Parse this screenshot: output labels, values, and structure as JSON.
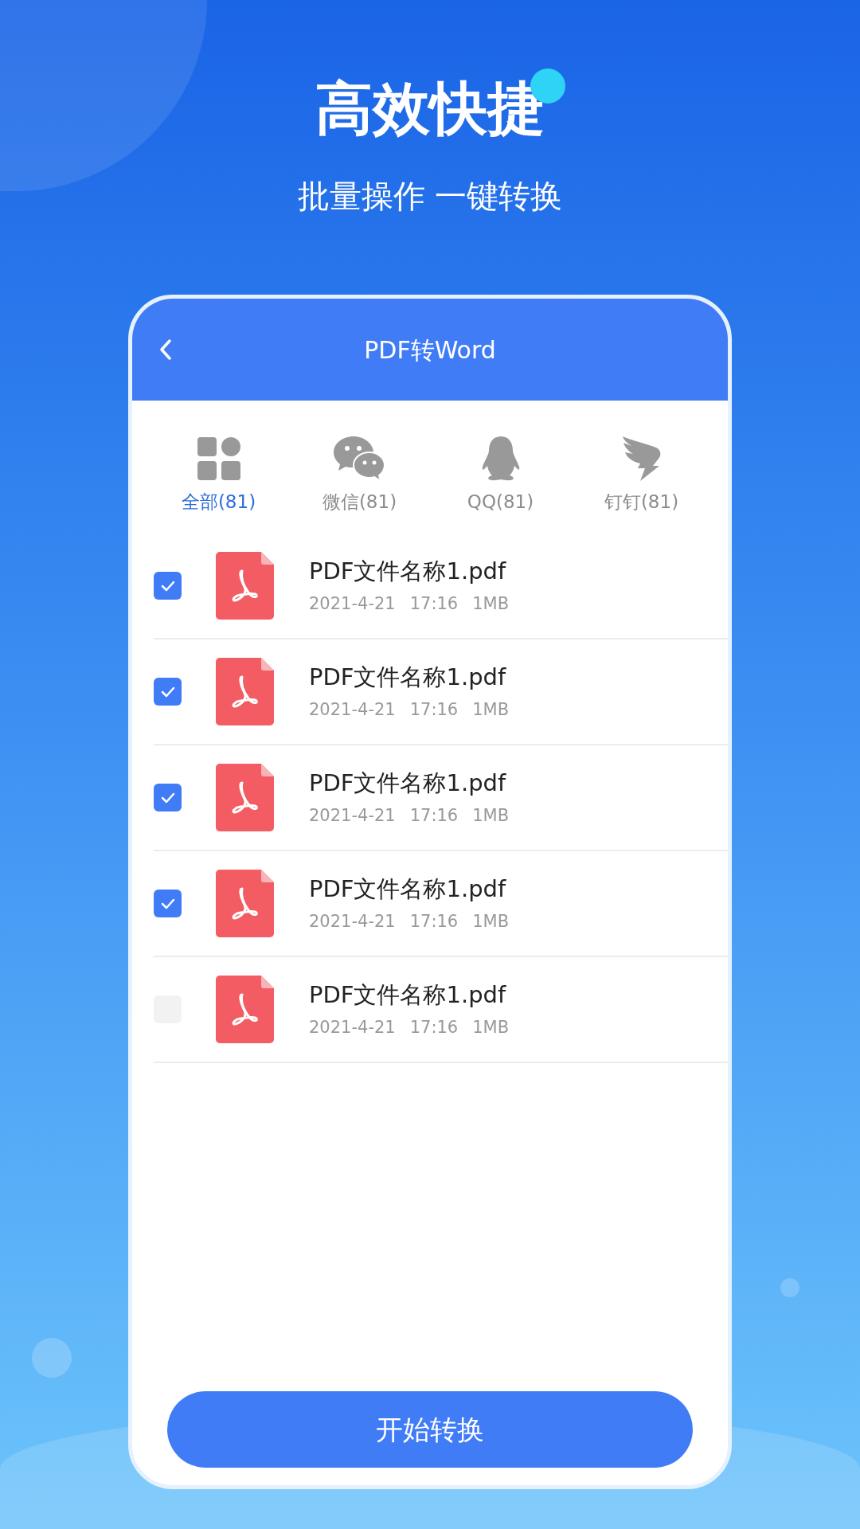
{
  "headline": "高效快捷",
  "subtitle": "批量操作 一键转换",
  "screen": {
    "title": "PDF转Word",
    "tabs": [
      {
        "kind": "all",
        "label": "全部(81)",
        "selected": true
      },
      {
        "kind": "chat",
        "label": "微信(81)",
        "selected": false
      },
      {
        "kind": "penguin",
        "label": "QQ(81)",
        "selected": false
      },
      {
        "kind": "wing",
        "label": "钉钉(81)",
        "selected": false
      }
    ],
    "files": [
      {
        "name": "PDF文件名称1.pdf",
        "date": "2021-4-21",
        "time": "17:16",
        "size": "1MB",
        "checked": true
      },
      {
        "name": "PDF文件名称1.pdf",
        "date": "2021-4-21",
        "time": "17:16",
        "size": "1MB",
        "checked": true
      },
      {
        "name": "PDF文件名称1.pdf",
        "date": "2021-4-21",
        "time": "17:16",
        "size": "1MB",
        "checked": true
      },
      {
        "name": "PDF文件名称1.pdf",
        "date": "2021-4-21",
        "time": "17:16",
        "size": "1MB",
        "checked": true
      },
      {
        "name": "PDF文件名称1.pdf",
        "date": "2021-4-21",
        "time": "17:16",
        "size": "1MB",
        "checked": false
      }
    ],
    "button": "开始转换"
  }
}
